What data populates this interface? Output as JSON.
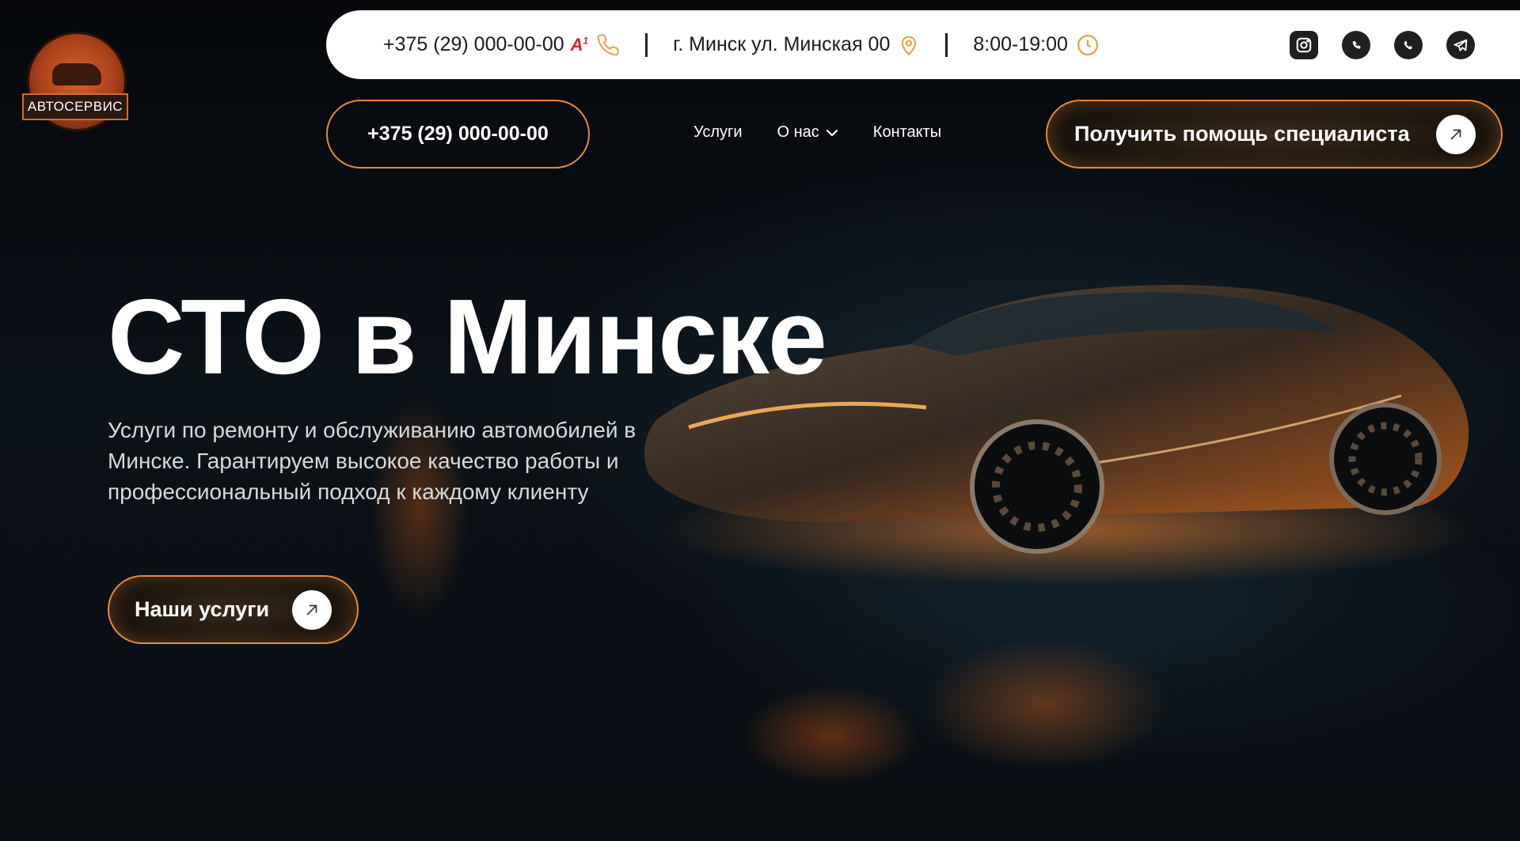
{
  "logo": {
    "plate_text": "АВТОСЕРВИС"
  },
  "topbar": {
    "phone": "+375 (29) 000-00-00",
    "operator": "A",
    "operator_sup": "1",
    "address": "г. Минск ул. Минская 00",
    "hours": "8:00-19:00",
    "socials": [
      "instagram-icon",
      "viber-icon",
      "whatsapp-icon",
      "telegram-icon"
    ]
  },
  "header": {
    "phone_button": "+375 (29) 000-00-00",
    "nav": [
      "Услуги",
      "О нас",
      "Контакты"
    ],
    "cta": "Получить помощь специалиста"
  },
  "hero": {
    "title": "СТО в Минске",
    "subtitle_lines": [
      "Услуги по ремонту и обслуживанию автомобилей в",
      "Минске. Гарантируем высокое качество работы и",
      "профессиональный подход к каждому клиенту"
    ],
    "button": "Наши услуги"
  },
  "colors": {
    "accent": "#e88a3c",
    "background": "#0a0f14",
    "topbar": "#ffffff"
  }
}
